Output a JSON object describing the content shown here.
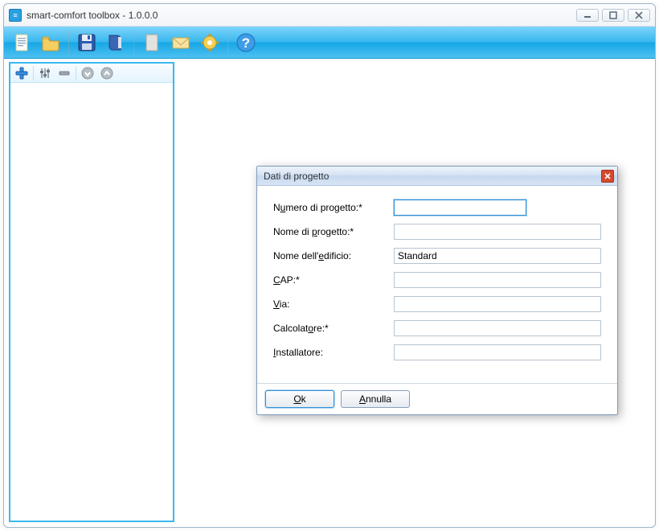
{
  "window": {
    "title": "smart-comfort toolbox - 1.0.0.0"
  },
  "colors": {
    "accent": "#39b8ef"
  },
  "toolbar": {
    "icons": {
      "new": "file-new-icon",
      "open": "folder-icon",
      "save": "floppy-icon",
      "book": "book-icon",
      "page": "page-icon",
      "mail": "mail-icon",
      "gear": "gear-icon",
      "help": "help-icon"
    }
  },
  "side": {
    "icons": {
      "add": "plus-icon",
      "sliders": "sliders-icon",
      "minus": "minus-icon",
      "down": "circle-down-icon",
      "up": "circle-up-icon"
    }
  },
  "dialog": {
    "title": "Dati di progetto",
    "fields": [
      {
        "key": "numero",
        "label_pre": "N",
        "label_ul": "u",
        "label_post": "mero di progetto:*",
        "value": "",
        "short": true,
        "focused": true
      },
      {
        "key": "nome",
        "label_pre": "Nome di ",
        "label_ul": "p",
        "label_post": "rogetto:*",
        "value": ""
      },
      {
        "key": "edificio",
        "label_pre": "Nome dell'",
        "label_ul": "e",
        "label_post": "dificio:",
        "value": "Standard"
      },
      {
        "key": "cap",
        "label_pre": "",
        "label_ul": "C",
        "label_post": "AP:*",
        "value": ""
      },
      {
        "key": "via",
        "label_pre": "",
        "label_ul": "V",
        "label_post": "ia:",
        "value": ""
      },
      {
        "key": "calc",
        "label_pre": "Calcolat",
        "label_ul": "o",
        "label_post": "re:*",
        "value": ""
      },
      {
        "key": "inst",
        "label_pre": "",
        "label_ul": "I",
        "label_post": "nstallatore:",
        "value": ""
      }
    ],
    "buttons": {
      "ok_pre": "",
      "ok_ul": "O",
      "ok_post": "k",
      "cancel_pre": "",
      "cancel_ul": "A",
      "cancel_post": "nnulla"
    }
  }
}
